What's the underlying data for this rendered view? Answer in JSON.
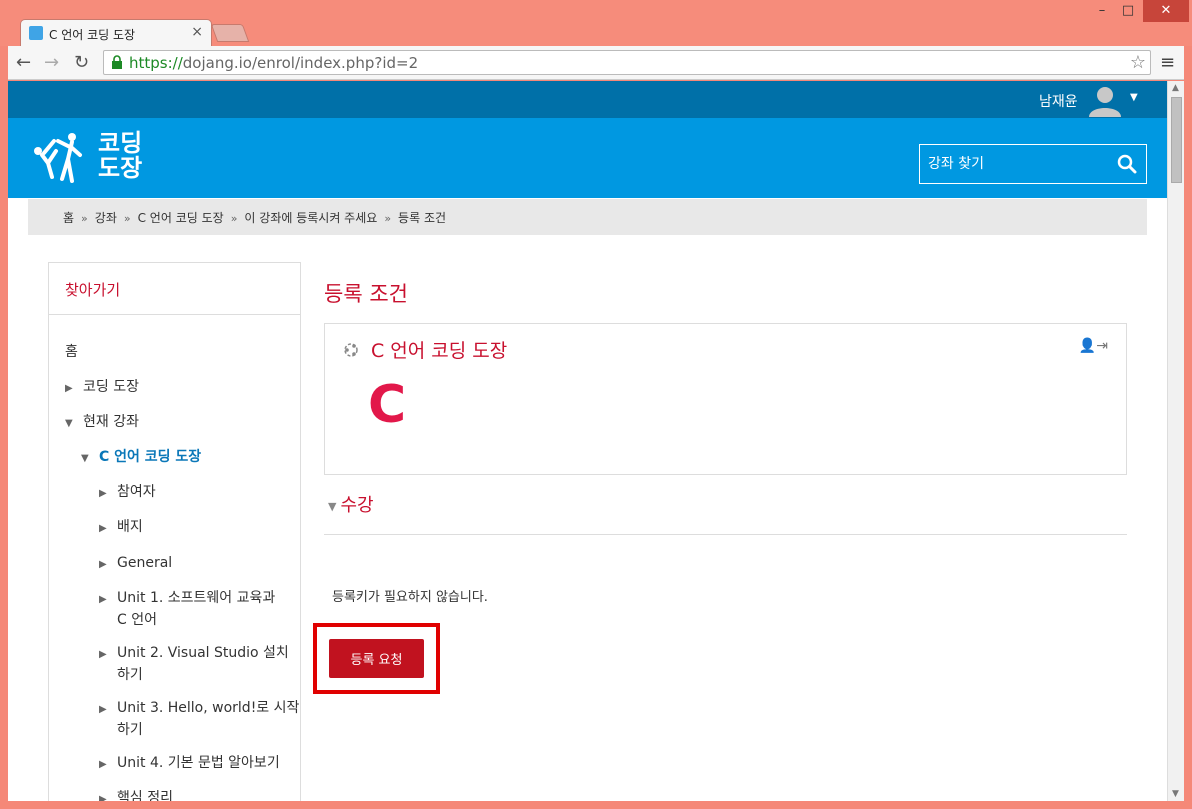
{
  "browser": {
    "tab_title": "C 언어 코딩 도장",
    "url_scheme": "https://",
    "url_rest": "dojang.io/enrol/index.php?id=2"
  },
  "topbar": {
    "username": "남재윤"
  },
  "header": {
    "logo_line1": "코딩",
    "logo_line2": "도장",
    "search_placeholder": "강좌 찾기"
  },
  "breadcrumb": [
    "홈",
    "강좌",
    "C 언어 코딩 도장",
    "이 강좌에 등록시켜 주세요",
    "등록 조건"
  ],
  "sidebar": {
    "title": "찾아가기",
    "items": [
      {
        "label": "홈"
      },
      {
        "label": "코딩 도장"
      },
      {
        "label": "현재 강좌"
      },
      {
        "label": "C 언어 코딩 도장"
      },
      {
        "label": "참여자"
      },
      {
        "label": "배지"
      },
      {
        "label": "General"
      },
      {
        "label": "Unit 1. 소프트웨어 교육과",
        "label2": "C 언어"
      },
      {
        "label": "Unit 2. Visual Studio 설치",
        "label2": "하기"
      },
      {
        "label": "Unit 3. Hello, world!로 시작",
        "label2": "하기"
      },
      {
        "label": "Unit 4. 기본 문법 알아보기"
      },
      {
        "label": "핵심 정리"
      }
    ]
  },
  "main": {
    "title": "등록 조건",
    "course_name": "C 언어 코딩 도장",
    "course_logo_letter": "C",
    "section": "수강",
    "note": "등록키가 필요하지 않습니다.",
    "enrol_button": "등록 요청"
  },
  "colors": {
    "accent": "#c8102e",
    "topbar": "#0070a8",
    "header": "#0098e1"
  }
}
